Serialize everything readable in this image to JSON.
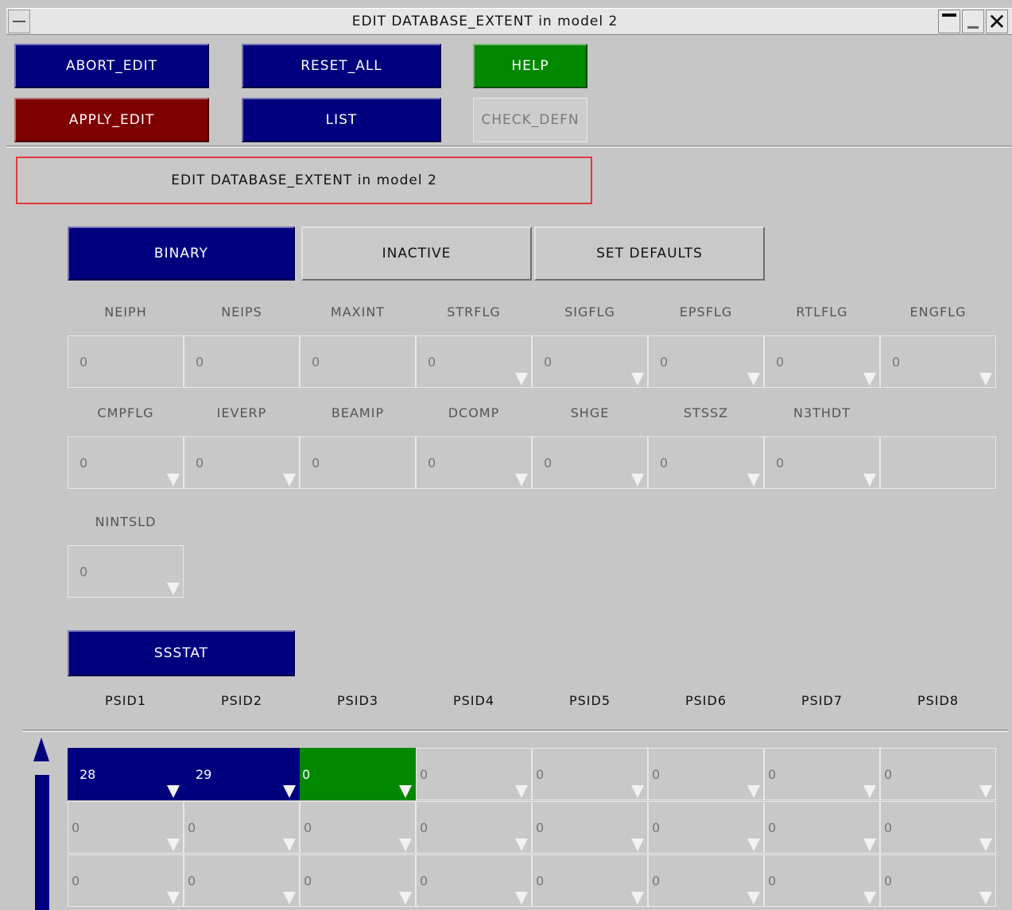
{
  "window": {
    "title": "EDIT DATABASE_EXTENT in model 2"
  },
  "toolbar": {
    "abort_edit": "ABORT_EDIT",
    "reset_all": "RESET_ALL",
    "help": "HELP",
    "apply_edit": "APPLY_EDIT",
    "list": "LIST",
    "check_defn": "CHECK_DEFN"
  },
  "header": {
    "text": "EDIT DATABASE_EXTENT in model 2"
  },
  "tabs": {
    "binary": "BINARY",
    "inactive": "INACTIVE",
    "set_defaults": "SET DEFAULTS"
  },
  "row1": {
    "labels": [
      "NEIPH",
      "NEIPS",
      "MAXINT",
      "STRFLG",
      "SIGFLG",
      "EPSFLG",
      "RTLFLG",
      "ENGFLG"
    ],
    "values": [
      "0",
      "0",
      "0",
      "0",
      "0",
      "0",
      "0",
      "0"
    ]
  },
  "row2": {
    "labels": [
      "CMPFLG",
      "IEVERP",
      "BEAMIP",
      "DCOMP",
      "SHGE",
      "STSSZ",
      "N3THDT"
    ],
    "values": [
      "0",
      "0",
      "0",
      "0",
      "0",
      "0",
      "0",
      ""
    ]
  },
  "row3": {
    "labels": [
      "NINTSLD"
    ],
    "values": [
      "0"
    ]
  },
  "ssstat": {
    "button": "SSSTAT",
    "labels": [
      "PSID1",
      "PSID2",
      "PSID3",
      "PSID4",
      "PSID5",
      "PSID6",
      "PSID7",
      "PSID8"
    ],
    "rows": [
      [
        "28",
        "29",
        "0",
        "0",
        "0",
        "0",
        "0",
        "0"
      ],
      [
        "0",
        "0",
        "0",
        "0",
        "0",
        "0",
        "0",
        "0"
      ],
      [
        "0",
        "0",
        "0",
        "0",
        "0",
        "0",
        "0",
        "0"
      ]
    ]
  },
  "colors": {
    "navy": "#00007f",
    "maroon": "#7f0000",
    "green": "#008800",
    "panel": "#c6c6c6",
    "highlight_border": "#e23b3b"
  }
}
